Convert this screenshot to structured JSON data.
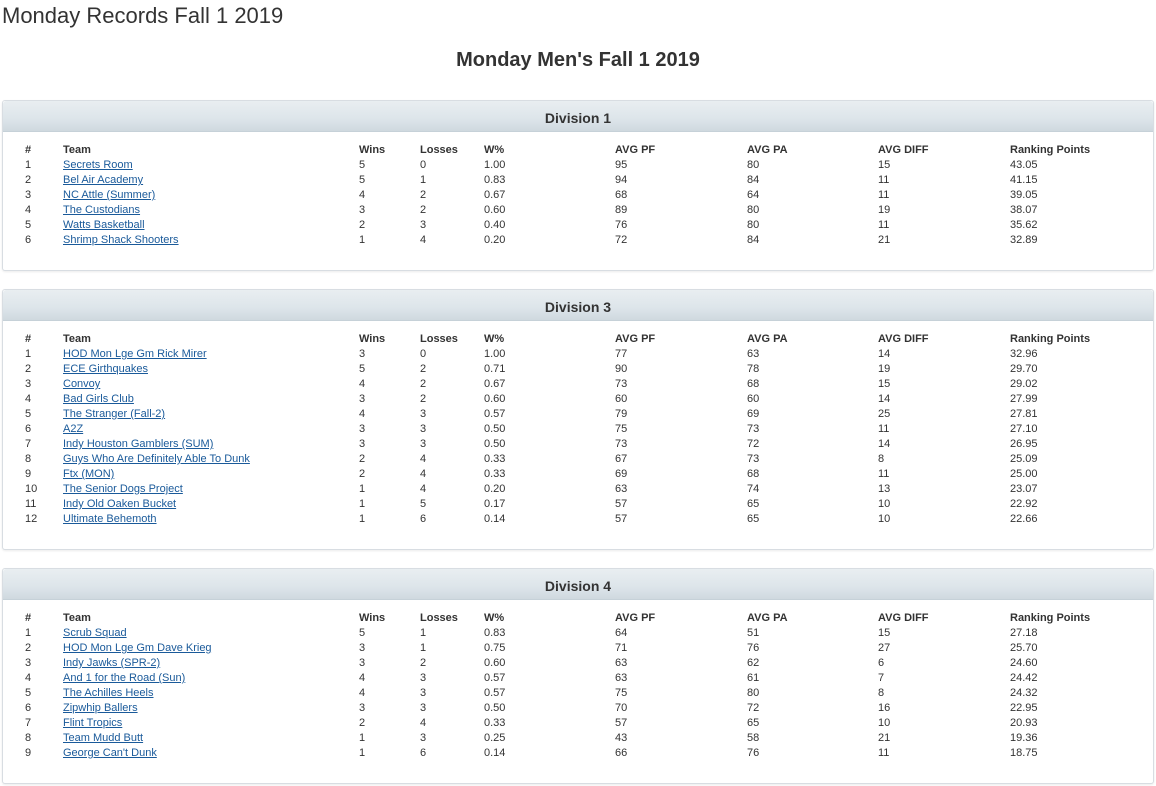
{
  "page_title": "Monday Records Fall 1 2019",
  "league_title": "Monday Men's Fall 1 2019",
  "columns": [
    "#",
    "Team",
    "Wins",
    "Losses",
    "W%",
    "AVG PF",
    "AVG PA",
    "AVG DIFF",
    "Ranking Points"
  ],
  "colors": {
    "link": "#1a5a9a",
    "header_bg": "#dde5ea",
    "text": "#333333"
  },
  "divisions": [
    {
      "name": "Division 1",
      "rows": [
        [
          "1",
          "Secrets Room",
          "5",
          "0",
          "1.00",
          "95",
          "80",
          "15",
          "43.05"
        ],
        [
          "2",
          "Bel Air Academy",
          "5",
          "1",
          "0.83",
          "94",
          "84",
          "11",
          "41.15"
        ],
        [
          "3",
          "NC Attle (Summer)",
          "4",
          "2",
          "0.67",
          "68",
          "64",
          "11",
          "39.05"
        ],
        [
          "4",
          "The Custodians",
          "3",
          "2",
          "0.60",
          "89",
          "80",
          "19",
          "38.07"
        ],
        [
          "5",
          "Watts Basketball",
          "2",
          "3",
          "0.40",
          "76",
          "80",
          "11",
          "35.62"
        ],
        [
          "6",
          "Shrimp Shack Shooters",
          "1",
          "4",
          "0.20",
          "72",
          "84",
          "21",
          "32.89"
        ]
      ]
    },
    {
      "name": "Division 3",
      "rows": [
        [
          "1",
          "HOD Mon Lge Gm Rick Mirer",
          "3",
          "0",
          "1.00",
          "77",
          "63",
          "14",
          "32.96"
        ],
        [
          "2",
          "ECE Girthquakes",
          "5",
          "2",
          "0.71",
          "90",
          "78",
          "19",
          "29.70"
        ],
        [
          "3",
          "Convoy",
          "4",
          "2",
          "0.67",
          "73",
          "68",
          "15",
          "29.02"
        ],
        [
          "4",
          "Bad Girls Club",
          "3",
          "2",
          "0.60",
          "60",
          "60",
          "14",
          "27.99"
        ],
        [
          "5",
          "The Stranger (Fall-2)",
          "4",
          "3",
          "0.57",
          "79",
          "69",
          "25",
          "27.81"
        ],
        [
          "6",
          "A2Z",
          "3",
          "3",
          "0.50",
          "75",
          "73",
          "11",
          "27.10"
        ],
        [
          "7",
          "Indy Houston Gamblers (SUM)",
          "3",
          "3",
          "0.50",
          "73",
          "72",
          "14",
          "26.95"
        ],
        [
          "8",
          "Guys Who Are Definitely Able To Dunk",
          "2",
          "4",
          "0.33",
          "67",
          "73",
          "8",
          "25.09"
        ],
        [
          "9",
          "Ftx (MON)",
          "2",
          "4",
          "0.33",
          "69",
          "68",
          "11",
          "25.00"
        ],
        [
          "10",
          "The Senior Dogs Project",
          "1",
          "4",
          "0.20",
          "63",
          "74",
          "13",
          "23.07"
        ],
        [
          "11",
          "Indy Old Oaken Bucket",
          "1",
          "5",
          "0.17",
          "57",
          "65",
          "10",
          "22.92"
        ],
        [
          "12",
          "Ultimate Behemoth",
          "1",
          "6",
          "0.14",
          "57",
          "65",
          "10",
          "22.66"
        ]
      ]
    },
    {
      "name": "Division 4",
      "rows": [
        [
          "1",
          "Scrub Squad",
          "5",
          "1",
          "0.83",
          "64",
          "51",
          "15",
          "27.18"
        ],
        [
          "2",
          "HOD Mon Lge Gm Dave Krieg",
          "3",
          "1",
          "0.75",
          "71",
          "76",
          "27",
          "25.70"
        ],
        [
          "3",
          "Indy Jawks (SPR-2)",
          "3",
          "2",
          "0.60",
          "63",
          "62",
          "6",
          "24.60"
        ],
        [
          "4",
          "And 1 for the Road (Sun)",
          "4",
          "3",
          "0.57",
          "63",
          "61",
          "7",
          "24.42"
        ],
        [
          "5",
          "The Achilles Heels",
          "4",
          "3",
          "0.57",
          "75",
          "80",
          "8",
          "24.32"
        ],
        [
          "6",
          "Zipwhip Ballers",
          "3",
          "3",
          "0.50",
          "70",
          "72",
          "16",
          "22.95"
        ],
        [
          "7",
          "Flint Tropics",
          "2",
          "4",
          "0.33",
          "57",
          "65",
          "10",
          "20.93"
        ],
        [
          "8",
          "Team Mudd Butt",
          "1",
          "3",
          "0.25",
          "43",
          "58",
          "21",
          "19.36"
        ],
        [
          "9",
          "George Can't Dunk",
          "1",
          "6",
          "0.14",
          "66",
          "76",
          "11",
          "18.75"
        ]
      ]
    }
  ]
}
